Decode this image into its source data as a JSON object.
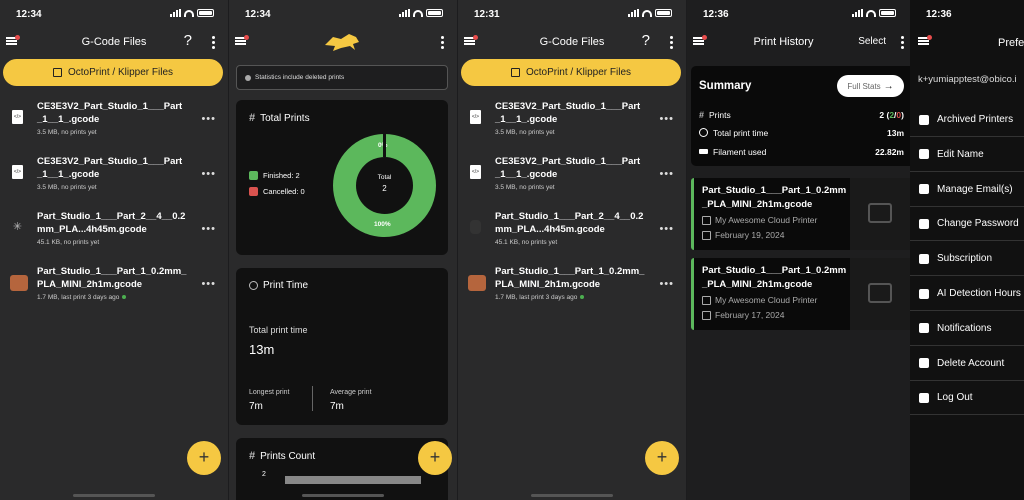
{
  "screens": [
    {
      "time": "12:34",
      "title": "G-Code Files",
      "octo_label": "OctoPrint / Klipper Files",
      "files": [
        {
          "name": "CE3E3V2_Part_Studio_1___Part_1__1_.gcode",
          "meta": "3.5 MB, no prints yet",
          "icon": "gcode-file-icon",
          "dot": false
        },
        {
          "name": "CE3E3V2_Part_Studio_1___Part_1__1_.gcode",
          "meta": "3.5 MB, no prints yet",
          "icon": "gcode-file-icon",
          "dot": false
        },
        {
          "name": "Part_Studio_1___Part_2__4__0.2mm_PLA...4h45m.gcode",
          "meta": "45.1 KB, no prints yet",
          "icon": "loading-spinner-icon",
          "dot": false
        },
        {
          "name": "Part_Studio_1___Part_1_0.2mm_PLA_MINI_2h1m.gcode",
          "meta": "1.7 MB, last print 3 days ago",
          "icon": "thumbnail-icon",
          "dot": true
        }
      ],
      "fab": "+"
    },
    {
      "time": "12:34",
      "notice": "Statistics include deleted prints",
      "total_prints": {
        "title": "Total Prints",
        "finished_label": "Finished: 2",
        "cancelled_label": "Cancelled: 0",
        "center_label": "Total",
        "center_value": "2",
        "top_label": "0%",
        "bottom_label": "100%",
        "finished_fraction": 1.0,
        "finished_color": "#5cb85c",
        "cancelled_color": "#d9534f"
      },
      "print_time": {
        "title": "Print Time",
        "total_label": "Total print time",
        "total_value": "13m",
        "longest_label": "Longest print",
        "longest_value": "7m",
        "average_label": "Average print",
        "average_value": "7m"
      },
      "prints_count": {
        "title": "Prints Count",
        "axis_tick": "2"
      },
      "fab": "+"
    },
    {
      "time": "12:31",
      "title": "G-Code Files",
      "octo_label": "OctoPrint / Klipper Files",
      "files": [
        {
          "name": "CE3E3V2_Part_Studio_1___Part_1__1_.gcode",
          "meta": "3.5 MB, no prints yet",
          "icon": "gcode-file-icon",
          "dot": false
        },
        {
          "name": "CE3E3V2_Part_Studio_1___Part_1__1_.gcode",
          "meta": "3.5 MB, no prints yet",
          "icon": "gcode-file-icon",
          "dot": false
        },
        {
          "name": "Part_Studio_1___Part_2__4__0.2mm_PLA...4h45m.gcode",
          "meta": "45.1 KB, no prints yet",
          "icon": "printer-thumb-icon",
          "dot": false
        },
        {
          "name": "Part_Studio_1___Part_1_0.2mm_PLA_MINI_2h1m.gcode",
          "meta": "1.7 MB, last print 3 days ago",
          "icon": "thumbnail-icon",
          "dot": true
        }
      ],
      "fab": "+"
    },
    {
      "time": "12:36",
      "title": "Print History",
      "select_label": "Select",
      "summary": {
        "title": "Summary",
        "full_stats_label": "Full Stats",
        "prints_label": "Prints",
        "prints_value": "2",
        "prints_done": "2",
        "prints_failed": "0",
        "time_label": "Total print time",
        "time_value": "13m",
        "filament_label": "Filament used",
        "filament_value": "22.82m"
      },
      "history": [
        {
          "name": "Part_Studio_1___Part_1_0.2mm_PLA_MINI_2h1m.gcode",
          "printer": "My Awesome Cloud Printer",
          "date": "February 19, 2024"
        },
        {
          "name": "Part_Studio_1___Part_1_0.2mm_PLA_MINI_2h1m.gcode",
          "printer": "My Awesome Cloud Printer",
          "date": "February 17, 2024"
        }
      ]
    },
    {
      "time": "12:36",
      "title": "Prefe",
      "email": "k+yumiapptest@obico.i",
      "menu": [
        {
          "label": "Archived Printers",
          "icon": "archive-printer-icon"
        },
        {
          "label": "Edit Name",
          "icon": "edit-user-icon"
        },
        {
          "label": "Manage Email(s)",
          "icon": "mail-icon"
        },
        {
          "label": "Change Password",
          "icon": "key-icon"
        },
        {
          "label": "Subscription",
          "icon": "card-icon"
        },
        {
          "label": "AI Detection Hours",
          "icon": "hourglass-icon"
        },
        {
          "label": "Notifications",
          "icon": "bell-icon"
        },
        {
          "label": "Delete Account",
          "icon": "trash-icon"
        },
        {
          "label": "Log Out",
          "icon": "logout-icon"
        }
      ]
    }
  ]
}
